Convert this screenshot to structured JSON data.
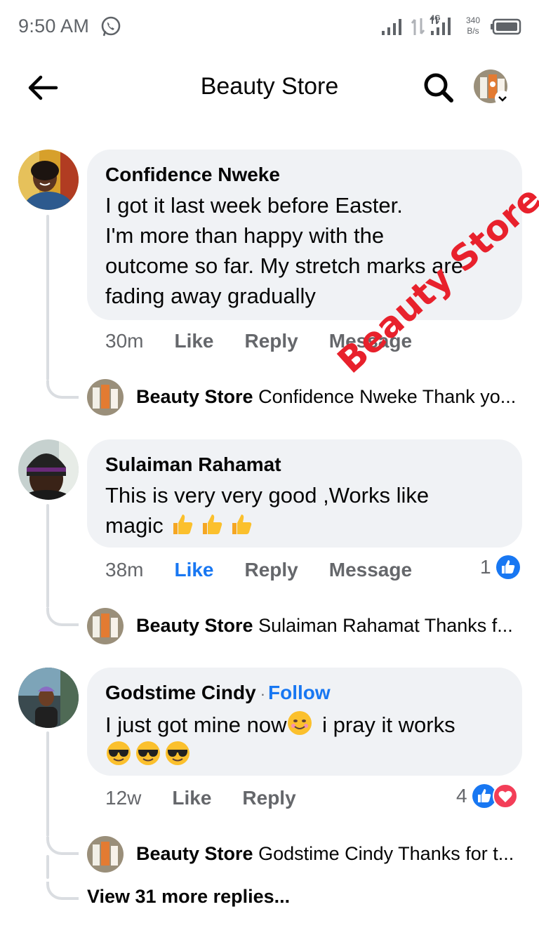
{
  "status_bar": {
    "time": "9:50 AM",
    "network_type": "4G",
    "speed_value": "340",
    "speed_unit": "B/s",
    "icons": [
      "whatsapp-icon",
      "signal-icon",
      "data-transfer-icon",
      "battery-icon"
    ]
  },
  "header": {
    "title": "Beauty Store",
    "back_icon": "arrow-left-icon",
    "search_icon": "search-icon"
  },
  "colors": {
    "accent": "#1877f2",
    "bubble": "#f0f2f5",
    "meta": "#65676b",
    "watermark": "#e8212c",
    "love": "#f33e58"
  },
  "comments": [
    {
      "author": "Confidence Nweke",
      "text_lines": [
        "I got it last week before Easter.",
        "I'm more than happy with the",
        "outcome so far. My stretch marks are",
        "fading away gradually"
      ],
      "time": "30m",
      "actions": [
        "Like",
        "Reply",
        "Message"
      ],
      "reply": {
        "author": "Beauty Store",
        "text": "Confidence Nweke Thank yo..."
      }
    },
    {
      "author": "Sulaiman Rahamat",
      "text_lines": [
        "This is very very good  ,Works like",
        "magic"
      ],
      "emojis": [
        "thumbs-up",
        "thumbs-up",
        "thumbs-up"
      ],
      "time": "38m",
      "actions": [
        "Like",
        "Reply",
        "Message"
      ],
      "liked": true,
      "reaction_count": "1",
      "reply": {
        "author": "Beauty Store",
        "text": "Sulaiman Rahamat Thanks f..."
      }
    },
    {
      "author": "Godstime Cindy",
      "follow": "Follow",
      "text_lines": [
        "I just got mine now",
        "i pray it works"
      ],
      "emojis_inline": [
        "smiling-face"
      ],
      "emojis_line2": [
        "sunglasses-face",
        "sunglasses-face",
        "sunglasses-face"
      ],
      "time": "12w",
      "actions": [
        "Like",
        "Reply"
      ],
      "reaction_count": "4",
      "reply": {
        "author": "Beauty Store",
        "text": "Godstime Cindy Thanks for t..."
      }
    }
  ],
  "more_replies": "View 31 more replies...",
  "watermark": "Beauty Store"
}
